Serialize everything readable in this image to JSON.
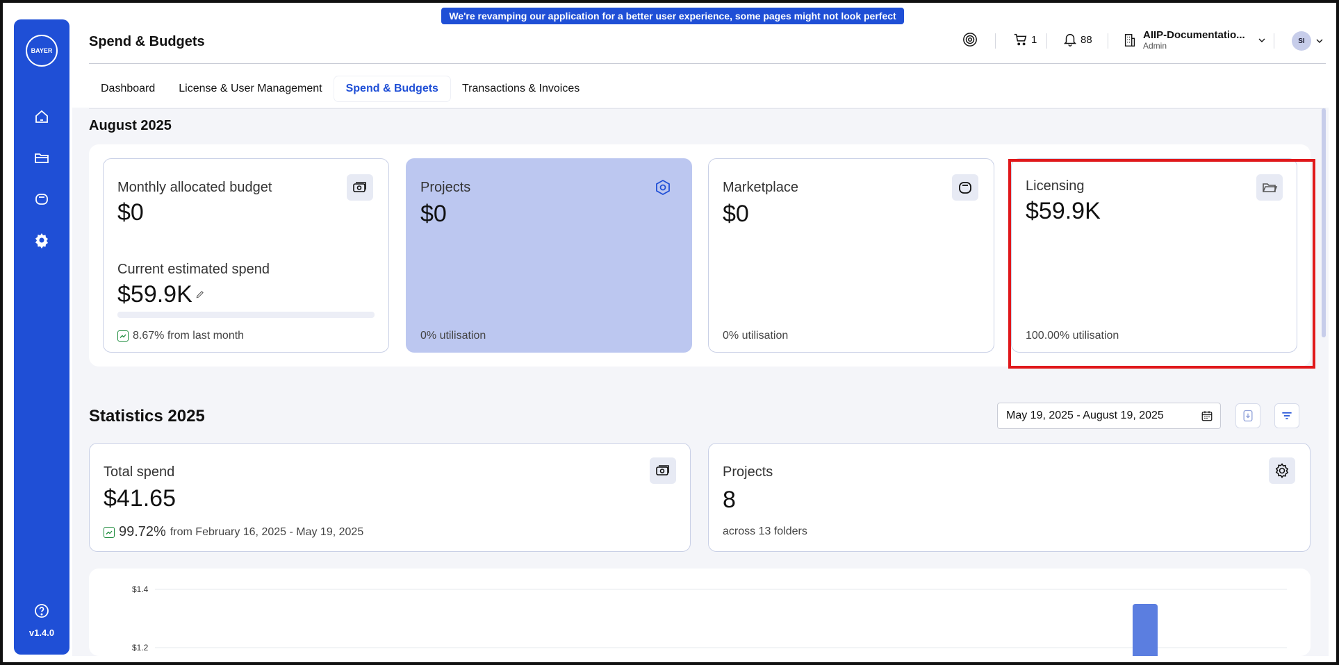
{
  "banner": {
    "text": "We're revamping our application for a better user experience, some pages might not look perfect yet!"
  },
  "sidebar": {
    "logo_text": "BAYER",
    "items": [
      {
        "icon": "home-icon"
      },
      {
        "icon": "folder-icon"
      },
      {
        "icon": "bag-icon"
      },
      {
        "icon": "gear-icon"
      }
    ],
    "help_icon": "help-icon",
    "version": "v1.4.0"
  },
  "header": {
    "title": "Spend & Budgets",
    "cart_count": "1",
    "notification_count": "88",
    "org_name": "AIIP-Documentatio...",
    "org_role": "Admin",
    "avatar_initials": "SI"
  },
  "tabs": [
    {
      "label": "Dashboard",
      "active": false
    },
    {
      "label": "License & User Management",
      "active": false
    },
    {
      "label": "Spend & Budgets",
      "active": true
    },
    {
      "label": "Transactions & Invoices",
      "active": false
    }
  ],
  "month_section": {
    "title": "August 2025",
    "budget_card": {
      "label": "Monthly allocated budget",
      "value": "$0",
      "estimate_label": "Current estimated spend",
      "estimate_value": "$59.9K",
      "trend_text": "8.67% from last month",
      "progress": 0
    },
    "projects_card": {
      "label": "Projects",
      "value": "$0",
      "foot": "0% utilisation"
    },
    "marketplace_card": {
      "label": "Marketplace",
      "value": "$0",
      "foot": "0% utilisation"
    },
    "licensing_card": {
      "label": "Licensing",
      "value": "$59.9K",
      "foot": "100.00% utilisation"
    }
  },
  "stats_section": {
    "title": "Statistics 2025",
    "date_range": "May 19, 2025 - August 19, 2025",
    "total_spend": {
      "label": "Total spend",
      "value": "$41.65",
      "trend_pct": "99.72%",
      "trend_text": "from February 16, 2025 - May 19, 2025"
    },
    "projects": {
      "label": "Projects",
      "value": "8",
      "foot": "across 13 folders"
    }
  },
  "chart_data": {
    "type": "bar",
    "y_ticks": [
      "$1.4",
      "$1.2"
    ],
    "ylim": [
      1.2,
      1.4
    ],
    "bars": [
      {
        "value": 1.35
      }
    ]
  },
  "colors": {
    "accent": "#1f4fd6",
    "blue_card": "#bcc7f0",
    "highlight": "#e0181b",
    "trend": "#1a8a3a"
  }
}
